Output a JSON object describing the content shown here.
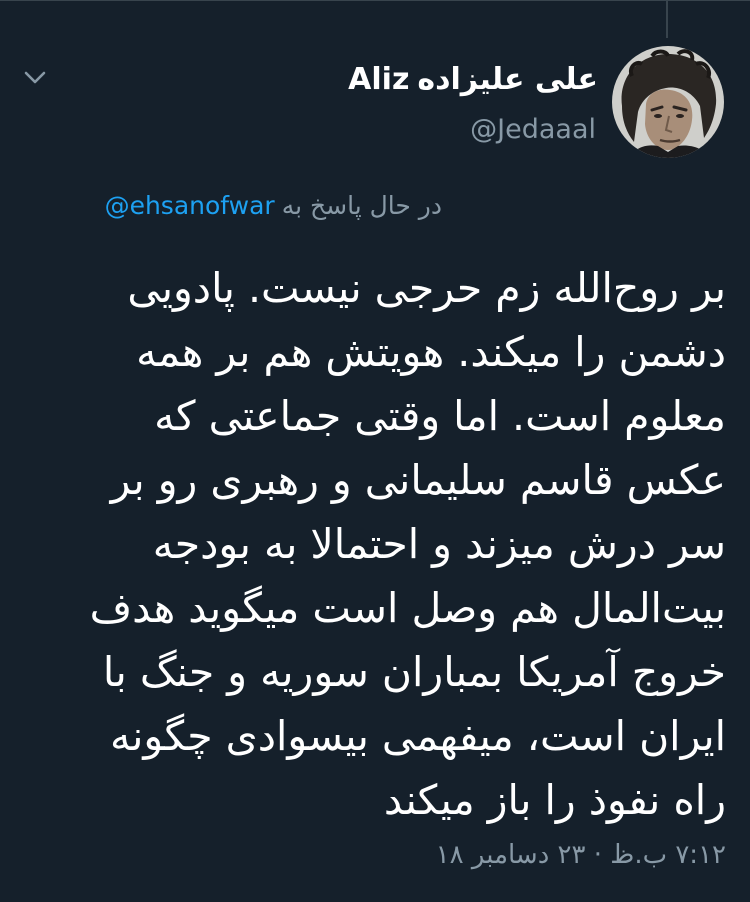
{
  "tweet": {
    "author": {
      "display_name_persian": "علی علیزاده",
      "display_name_latin": "Aliz",
      "handle": "@Jedaaal"
    },
    "reply": {
      "prefix": "در حال پاسخ به",
      "mention": "@ehsanofwar"
    },
    "body_lines": [
      "بر روح‌الله زم حرجی نیست. پادویی",
      "دشمن را میکند. هویتش هم بر همه",
      "معلوم است. اما وقتی جماعتی که",
      "عکس قاسم سلیمانی و رهبری رو بر",
      "سر درش میزند و احتمالا به بودجه",
      "بیت‌المال هم وصل است میگوید هدف",
      "خروج آمریکا بمباران سوریه و جنگ با",
      "ایران است، میفهمی بیسوادی چگونه",
      "راه نفوذ را باز میکند"
    ],
    "timestamp": "۷:۱۲ ب.ظ · ۲۳ دسامبر ۱۸"
  },
  "icons": {
    "avatar": "profile-photo",
    "menu": "chevron-down-icon"
  },
  "colors": {
    "background": "#15202b",
    "secondary_text": "#8899a6",
    "link": "#1da1f2",
    "divider": "#38444d"
  }
}
